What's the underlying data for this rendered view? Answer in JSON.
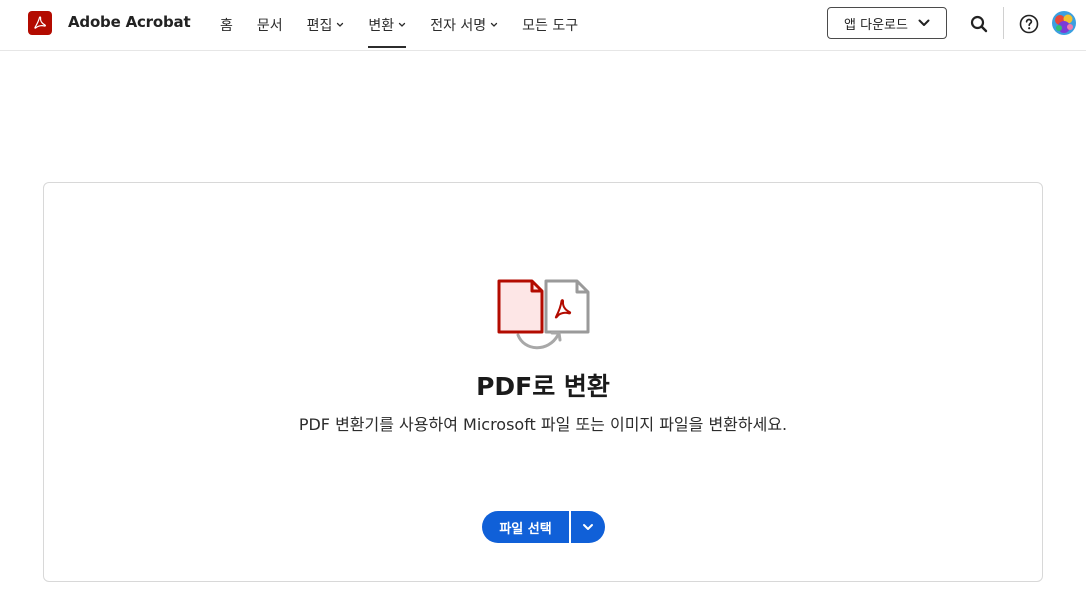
{
  "header": {
    "app_name": "Adobe Acrobat",
    "nav": [
      {
        "label": "홈",
        "dropdown": false,
        "active": false
      },
      {
        "label": "문서",
        "dropdown": false,
        "active": false
      },
      {
        "label": "편집",
        "dropdown": true,
        "active": false
      },
      {
        "label": "변환",
        "dropdown": true,
        "active": true
      },
      {
        "label": "전자 서명",
        "dropdown": true,
        "active": false
      },
      {
        "label": "모든 도구",
        "dropdown": false,
        "active": false
      }
    ],
    "download_label": "앱 다운로드",
    "icons": {
      "logo": "acrobat-logo-icon",
      "search": "search-icon",
      "help": "help-icon",
      "download_chevron": "chevron-down-icon"
    }
  },
  "main": {
    "title": "PDF로 변환",
    "description": "PDF 변환기를 사용하여 Microsoft 파일 또는 이미지 파일을 변환하세요.",
    "select_button": "파일 선택",
    "illustration": "convert-to-pdf-icon"
  },
  "colors": {
    "brand_red": "#b30b00",
    "primary_blue": "#1060d8",
    "text": "#2c2c2c",
    "border": "#d8d8d8"
  }
}
